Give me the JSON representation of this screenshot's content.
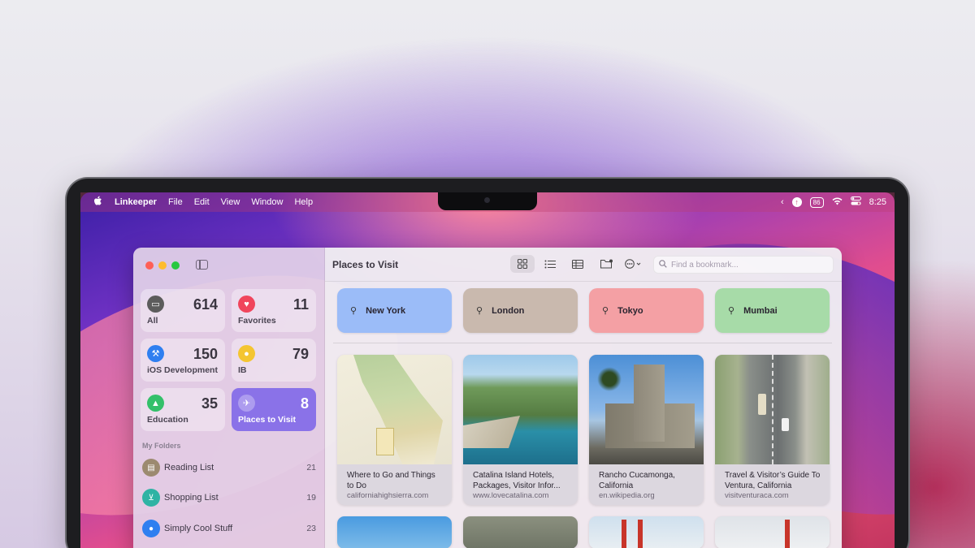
{
  "menubar": {
    "apple_icon": "apple-icon",
    "app_name": "Linkeeper",
    "menus": [
      "File",
      "Edit",
      "View",
      "Window",
      "Help"
    ],
    "battery": "86",
    "time": "8:25"
  },
  "toolbar": {
    "title": "Places to Visit",
    "search_placeholder": "Find a bookmark..."
  },
  "sidebar": {
    "cards": [
      {
        "label": "All",
        "count": "614",
        "icon": "tray-icon",
        "color": "#5c5c5c"
      },
      {
        "label": "Favorites",
        "count": "11",
        "icon": "heart-icon",
        "color": "#f0455c"
      },
      {
        "label": "iOS Development",
        "count": "150",
        "icon": "hammer-icon",
        "color": "#2f7ff0"
      },
      {
        "label": "IB",
        "count": "79",
        "icon": "flame-icon",
        "color": "#f4c531"
      },
      {
        "label": "Education",
        "count": "35",
        "icon": "graduation-cap-icon",
        "color": "#34c06a"
      },
      {
        "label": "Places to Visit",
        "count": "8",
        "icon": "airplane-icon",
        "color": "#8a72e8"
      }
    ],
    "folders_heading": "My Folders",
    "folders": [
      {
        "name": "Reading List",
        "count": "21",
        "icon": "book-icon",
        "color": "#9c8a70"
      },
      {
        "name": "Shopping List",
        "count": "19",
        "icon": "cart-icon",
        "color": "#2fb3a4"
      },
      {
        "name": "Simply Cool Stuff",
        "count": "23",
        "icon": "flame-icon",
        "color": "#2f7ff0"
      }
    ]
  },
  "pinned": [
    {
      "label": "New York",
      "color": "#9bbcf8"
    },
    {
      "label": "London",
      "color": "#c9b9ae"
    },
    {
      "label": "Tokyo",
      "color": "#f4a0a4"
    },
    {
      "label": "Mumbai",
      "color": "#a7dba8"
    }
  ],
  "bookmarks": [
    {
      "title": "Where to Go and Things to Do",
      "url": "californiahighsierra.com"
    },
    {
      "title": "Catalina Island Hotels, Packages, Visitor Infor...",
      "url": "www.lovecatalina.com"
    },
    {
      "title": "Rancho Cucamonga, California",
      "url": "en.wikipedia.org"
    },
    {
      "title": "Travel & Visitor’s Guide To Ventura, California",
      "url": "visitventuraca.com"
    }
  ]
}
